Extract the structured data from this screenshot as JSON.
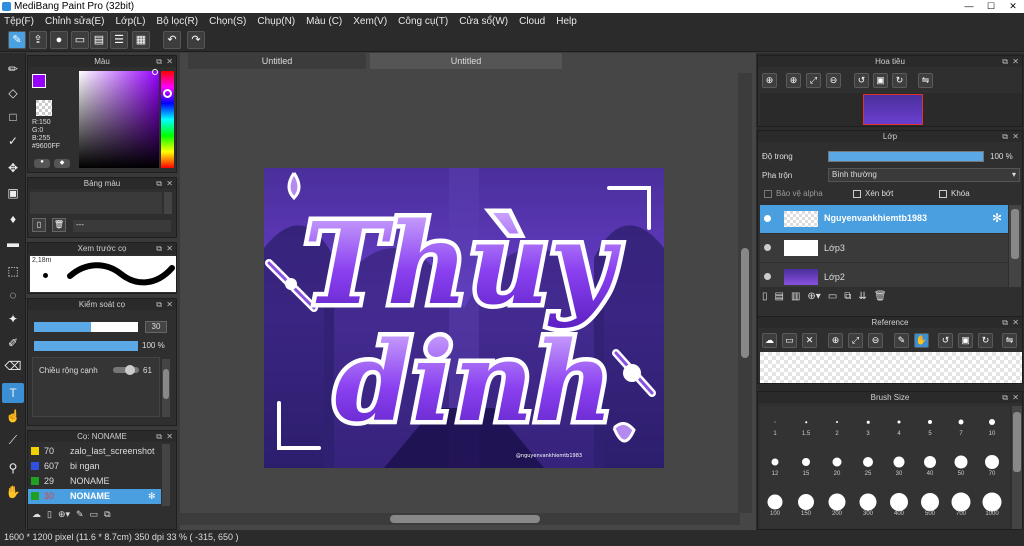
{
  "window": {
    "title": "MediBang Paint Pro (32bit)"
  },
  "menu": [
    "Tệp(F)",
    "Chỉnh sửa(E)",
    "Lớp(L)",
    "Bộ lọc(R)",
    "Chọn(S)",
    "Chụp(N)",
    "Màu (C)",
    "Xem(V)",
    "Công cụ(T)",
    "Cửa sổ(W)",
    "Cloud",
    "Help"
  ],
  "toolbar": {
    "icons": [
      "brush-settings-icon",
      "upload-icon",
      "chat-icon",
      "memo-icon",
      "document-icon",
      "layer-list-icon",
      "grid-icon",
      "undo-icon",
      "redo-icon"
    ]
  },
  "left_tools": [
    "brush-icon",
    "eraser-icon",
    "rectangle-icon",
    "select-pen-icon",
    "move-icon",
    "fill-icon",
    "bucket-icon",
    "gradient-icon",
    "select-rect-icon",
    "lasso-icon",
    "magic-wand-icon",
    "select-pen2-icon",
    "select-eraser-icon",
    "text-icon",
    "operation-icon",
    "divide-icon",
    "eyedropper-icon",
    "hand-icon"
  ],
  "color_panel": {
    "title": "Màu",
    "r": "R:150",
    "g": "G:0",
    "b": "B:255",
    "hex": "#9600FF",
    "fg_color": "#9600ff"
  },
  "palette_panel": {
    "title": "Bảng màu",
    "empty": "---"
  },
  "brush_preview_panel": {
    "title": "Xem trước cọ",
    "size_label": "2,18m"
  },
  "brush_control": {
    "title": "Kiểm soát cọ",
    "size_value": "30",
    "size_fraction": 0.55,
    "opacity_value": "100 %",
    "opacity_fraction": 1.0,
    "edge_label": "Chiều rộng cạnh",
    "edge_value": "61"
  },
  "brush_list": {
    "title": "Cọ: NONAME",
    "items": [
      {
        "size": "70",
        "name": "zalo_last_screenshot",
        "color": "#f0d000"
      },
      {
        "size": "607",
        "name": "bi ngan",
        "color": "#3050e0"
      },
      {
        "size": "29",
        "name": "NONAME",
        "color": "#20a020"
      },
      {
        "size": "30",
        "name": "NONAME",
        "color": "#20a020"
      }
    ]
  },
  "doc_tabs": [
    "Untitled",
    "Untitled"
  ],
  "artwork": {
    "text_line1": "Thùy",
    "text_line2": "dinh",
    "watermark": "@nguyenvankhiemtb1983"
  },
  "navigator": {
    "title": "Hoa tiêu"
  },
  "layer_panel": {
    "title": "Lớp",
    "opacity_label": "Độ trong",
    "opacity_value": "100 %",
    "blend_label": "Pha trộn",
    "blend_value": "Bình thường",
    "protect_alpha": "Bảo vệ alpha",
    "clipping": "Xén bớt",
    "lock": "Khóa",
    "layers": [
      {
        "name": "Nguyenvankhiemtb1983",
        "selected": true
      },
      {
        "name": "Lớp3",
        "selected": false
      },
      {
        "name": "Lớp2",
        "selected": false
      }
    ]
  },
  "reference_panel": {
    "title": "Reference"
  },
  "brush_size_panel": {
    "title": "Brush Size",
    "sizes": [
      "1",
      "1.5",
      "2",
      "3",
      "4",
      "5",
      "7",
      "10",
      "12",
      "15",
      "20",
      "25",
      "30",
      "40",
      "50",
      "70",
      "100",
      "150",
      "200",
      "300",
      "400",
      "500",
      "700",
      "1000"
    ]
  },
  "status": {
    "text": "1600 * 1200 pixel   (11.6 * 8.7cm)  350 dpi   33 %   ( -315, 650 )"
  }
}
